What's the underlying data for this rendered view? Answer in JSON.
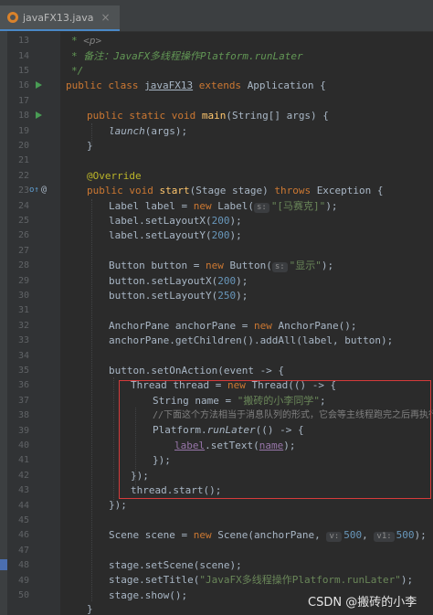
{
  "tab": {
    "filename": "javaFX13.java",
    "close_icon": "×"
  },
  "line_numbers": [
    "13",
    "14",
    "15",
    "16",
    "17",
    "18",
    "19",
    "20",
    "21",
    "22",
    "23",
    "24",
    "25",
    "26",
    "27",
    "28",
    "29",
    "30",
    "31",
    "32",
    "33",
    "34",
    "35",
    "36",
    "37",
    "38",
    "39",
    "40",
    "41",
    "42",
    "43",
    "44",
    "45",
    "46",
    "47",
    "48",
    "49",
    "50"
  ],
  "code": {
    "l13_a": "* ",
    "l13_b": "<p>",
    "l14": "* 备注：JavaFX多线程操作Platform.runLater",
    "l15": "*/",
    "l16_a": "public class ",
    "l16_b": "javaFX13",
    "l16_c": " extends ",
    "l16_d": "Application {",
    "l18_a": "public static void ",
    "l18_b": "main",
    "l18_c": "(String[] args) {",
    "l19_a": "launch",
    "l19_b": "(args);",
    "l20": "}",
    "l22": "@Override",
    "l23_a": "public void ",
    "l23_b": "start",
    "l23_c": "(Stage stage) ",
    "l23_d": "throws ",
    "l23_e": "Exception {",
    "l24_a": "Label label = ",
    "l24_b": "new ",
    "l24_c": "Label(",
    "l24_hint": "s:",
    "l24_d": "\"[马赛克]\"",
    "l24_e": ");",
    "l25_a": "label.setLayoutX(",
    "l25_b": "200",
    "l25_c": ");",
    "l26_a": "label.setLayoutY(",
    "l26_b": "200",
    "l26_c": ");",
    "l28_a": "Button button = ",
    "l28_b": "new ",
    "l28_c": "Button(",
    "l28_hint": "s:",
    "l28_d": "\"显示\"",
    "l28_e": ");",
    "l29_a": "button.setLayoutX(",
    "l29_b": "200",
    "l29_c": ");",
    "l30_a": "button.setLayoutY(",
    "l30_b": "250",
    "l30_c": ");",
    "l32_a": "AnchorPane anchorPane = ",
    "l32_b": "new ",
    "l32_c": "AnchorPane();",
    "l33": "anchorPane.getChildren().addAll(label, button);",
    "l35": "button.setOnAction(event -> {",
    "l36_a": "Thread thread = ",
    "l36_b": "new ",
    "l36_c": "Thread(() -> {",
    "l37_a": "String name = ",
    "l37_b": "\"搬砖的小李同学\"",
    "l37_c": ";",
    "l38": "//下面这个方法相当于消息队列的形式，它会等主线程跑完之后再执行",
    "l39_a": "Platform.",
    "l39_b": "runLater",
    "l39_c": "(() -> {",
    "l40_a": "label",
    "l40_b": ".setText(",
    "l40_c": "name",
    "l40_d": ");",
    "l41": "});",
    "l42": "});",
    "l43": "thread.start();",
    "l44": "});",
    "l46_a": "Scene scene = ",
    "l46_b": "new ",
    "l46_c": "Scene(anchorPane, ",
    "l46_hint1": "v:",
    "l46_d": "500",
    "l46_e": ", ",
    "l46_hint2": "v1:",
    "l46_f": "500",
    "l46_g": ");",
    "l48": "stage.setScene(scene);",
    "l49_a": "stage.setTitle(",
    "l49_b": "\"JavaFX多线程操作Platform.runLater\"",
    "l49_c": ");",
    "l50": "stage.show();",
    "l51": "}"
  },
  "gutter": {
    "override_icon": "o↑",
    "at_icon": "@"
  },
  "watermark": "CSDN @搬砖的小李",
  "colors": {
    "background": "#2b2b2b",
    "keyword": "#cc7832",
    "string": "#6a8759",
    "number": "#6897bb",
    "method": "#ffc66d",
    "annotation": "#bbb529",
    "highlight_box": "#d63b3b"
  }
}
